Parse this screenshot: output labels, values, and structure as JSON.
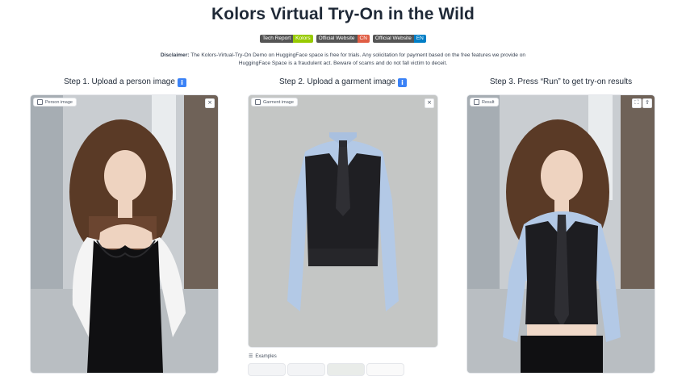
{
  "title": "Kolors Virtual Try-On in the Wild",
  "badges": [
    {
      "left": "Tech Report",
      "right": "Kolors",
      "color": "#97ca00"
    },
    {
      "left": "Official Website",
      "right": "CN",
      "color": "#e05d44"
    },
    {
      "left": "Official Website",
      "right": "EN",
      "color": "#007ec6"
    }
  ],
  "disclaimer": {
    "label": "Disclaimer:",
    "text": "The Kolors-Virtual-Try-On Demo on HuggingFace space is free for trials. Any solicitation for payment based on the free features we provide on HuggingFace Space is a fraudulent act. Beware of scams and do not fall victim to deceit."
  },
  "steps": [
    {
      "label": "Step 1. Upload a person image",
      "icon": "info-icon"
    },
    {
      "label": "Step 2. Upload a garment image",
      "icon": "info-icon"
    },
    {
      "label": "Step 3. Press “Run” to get try-on results",
      "icon": ""
    }
  ],
  "panels": {
    "person": {
      "label": "Person image",
      "close": "×"
    },
    "garment": {
      "label": "Garment image",
      "close": "×"
    },
    "result": {
      "label": "Result",
      "fullscreen": "⛶",
      "share": "⇪"
    }
  },
  "examples_label": "Examples",
  "info_glyph": "i"
}
